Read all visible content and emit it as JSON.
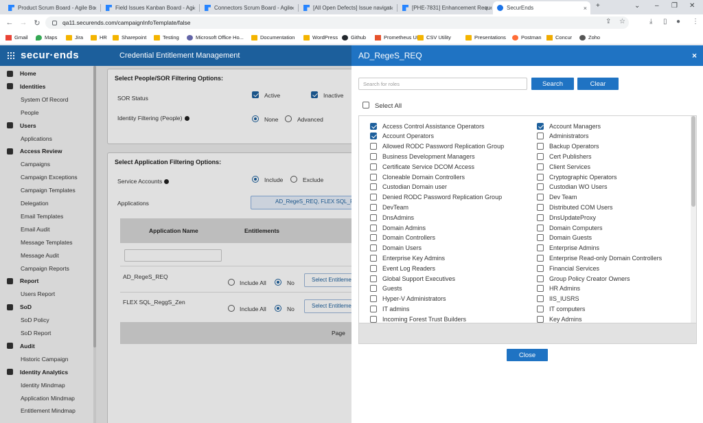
{
  "browser": {
    "tabs": [
      {
        "label": "Product Scrum Board - Agile Bo"
      },
      {
        "label": "Field Issues Kanban Board - Agi"
      },
      {
        "label": "Connectors Scrum Board - Agile"
      },
      {
        "label": "[All Open Defects] Issue navigat"
      },
      {
        "label": "[PHE-7831] Enhancement Reque"
      },
      {
        "label": "SecurEnds"
      }
    ],
    "new_tab": "+",
    "url": "qa11.securends.com/campaignInfoTemplate/false",
    "bookmarks": [
      {
        "label": "Gmail"
      },
      {
        "label": "Maps"
      },
      {
        "label": "Jira"
      },
      {
        "label": "HR"
      },
      {
        "label": "Sharepoint"
      },
      {
        "label": "Testing"
      },
      {
        "label": "Microsoft Office Ho..."
      },
      {
        "label": "Documentation"
      },
      {
        "label": "WordPress"
      },
      {
        "label": "Github"
      },
      {
        "label": "Prometheus UI"
      },
      {
        "label": "CSV Utility"
      },
      {
        "label": "Presentations"
      },
      {
        "label": "Postman"
      },
      {
        "label": "Concur"
      },
      {
        "label": "Zoho"
      }
    ]
  },
  "app": {
    "logo": "secur·ends",
    "title": "Credential Entitlement Management"
  },
  "sidebar": [
    {
      "type": "sec",
      "label": "Home",
      "icon": "home-icon"
    },
    {
      "type": "sec",
      "label": "Identities",
      "icon": "people-icon"
    },
    {
      "type": "sub",
      "label": "System Of Record"
    },
    {
      "type": "sub",
      "label": "People"
    },
    {
      "type": "sec",
      "label": "Users",
      "icon": "user-icon"
    },
    {
      "type": "sub",
      "label": "Applications"
    },
    {
      "type": "sec",
      "label": "Access Review",
      "icon": "access-review-icon"
    },
    {
      "type": "sub",
      "label": "Campaigns"
    },
    {
      "type": "sub",
      "label": "Campaign Exceptions"
    },
    {
      "type": "sub",
      "label": "Campaign Templates"
    },
    {
      "type": "sub",
      "label": "Delegation"
    },
    {
      "type": "sub",
      "label": "Email Templates"
    },
    {
      "type": "sub",
      "label": "Email Audit"
    },
    {
      "type": "sub",
      "label": "Message Templates"
    },
    {
      "type": "sub",
      "label": "Message Audit"
    },
    {
      "type": "sub",
      "label": "Campaign Reports"
    },
    {
      "type": "sec",
      "label": "Report",
      "icon": "report-icon"
    },
    {
      "type": "sub",
      "label": "Users Report"
    },
    {
      "type": "sec",
      "label": "SoD",
      "icon": "sod-icon"
    },
    {
      "type": "sub",
      "label": "SoD Policy"
    },
    {
      "type": "sub",
      "label": "SoD Report"
    },
    {
      "type": "sec",
      "label": "Audit",
      "icon": "shield-icon"
    },
    {
      "type": "sub",
      "label": "Historic Campaign"
    },
    {
      "type": "sec",
      "label": "Identity Analytics",
      "icon": "analytics-icon"
    },
    {
      "type": "sub",
      "label": "Identity Mindmap"
    },
    {
      "type": "sub",
      "label": "Application Mindmap"
    },
    {
      "type": "sub",
      "label": "Entitlement Mindmap"
    }
  ],
  "main": {
    "people_panel": {
      "title": "Select People/SOR Filtering Options:",
      "sor_status_label": "SOR Status",
      "active_label": "Active",
      "inactive_label": "Inactive",
      "identity_filtering_label": "Identity Filtering (People)",
      "none_label": "None",
      "advanced_label": "Advanced"
    },
    "app_panel": {
      "title": "Select Application Filtering Options:",
      "service_accounts_label": "Service Accounts",
      "include_label": "Include",
      "exclude_label": "Exclude",
      "applications_label": "Applications",
      "applications_value": "AD_RegeS_REQ, FLEX SQL_Re",
      "col_app_name": "Application Name",
      "col_entitlements": "Entitlements",
      "rows": [
        {
          "name": "AD_RegeS_REQ",
          "include_all": "Include All",
          "no": "No",
          "select": "Select Entitlements"
        },
        {
          "name": "FLEX SQL_ReggS_Zen",
          "include_all": "Include All",
          "no": "No",
          "select": "Select Entitlements"
        }
      ],
      "page_label": "Page"
    }
  },
  "modal": {
    "title": "AD_RegeS_REQ",
    "close_icon": "×",
    "search_placeholder": "Search for roles",
    "search_button": "Search",
    "clear_button": "Clear",
    "select_all_label": "Select All",
    "close_button": "Close",
    "roles_left": [
      {
        "label": "Access Control Assistance Operators",
        "checked": true
      },
      {
        "label": "Account Operators",
        "checked": true
      },
      {
        "label": "Allowed RODC Password Replication Group",
        "checked": false
      },
      {
        "label": "Business Development Managers",
        "checked": false
      },
      {
        "label": "Certificate Service DCOM Access",
        "checked": false
      },
      {
        "label": "Cloneable Domain Controllers",
        "checked": false
      },
      {
        "label": "Custodian Domain user",
        "checked": false
      },
      {
        "label": "Denied RODC Password Replication Group",
        "checked": false
      },
      {
        "label": "DevTeam",
        "checked": false
      },
      {
        "label": "DnsAdmins",
        "checked": false
      },
      {
        "label": "Domain Admins",
        "checked": false
      },
      {
        "label": "Domain Controllers",
        "checked": false
      },
      {
        "label": "Domain Users",
        "checked": false
      },
      {
        "label": "Enterprise Key Admins",
        "checked": false
      },
      {
        "label": "Event Log Readers",
        "checked": false
      },
      {
        "label": "Global Support Executives",
        "checked": false
      },
      {
        "label": "Guests",
        "checked": false
      },
      {
        "label": "Hyper-V Administrators",
        "checked": false
      },
      {
        "label": "IT admins",
        "checked": false
      },
      {
        "label": "Incoming Forest Trust Builders",
        "checked": false
      }
    ],
    "roles_right": [
      {
        "label": "Account Managers",
        "checked": true
      },
      {
        "label": "Administrators",
        "checked": false
      },
      {
        "label": "Backup Operators",
        "checked": false
      },
      {
        "label": "Cert Publishers",
        "checked": false
      },
      {
        "label": "Client Services",
        "checked": false
      },
      {
        "label": "Cryptographic Operators",
        "checked": false
      },
      {
        "label": "Custodian WO Users",
        "checked": false
      },
      {
        "label": "Dev Team",
        "checked": false
      },
      {
        "label": "Distributed COM Users",
        "checked": false
      },
      {
        "label": "DnsUpdateProxy",
        "checked": false
      },
      {
        "label": "Domain Computers",
        "checked": false
      },
      {
        "label": "Domain Guests",
        "checked": false
      },
      {
        "label": "Enterprise Admins",
        "checked": false
      },
      {
        "label": "Enterprise Read-only Domain Controllers",
        "checked": false
      },
      {
        "label": "Financial Services",
        "checked": false
      },
      {
        "label": "Group Policy Creator Owners",
        "checked": false
      },
      {
        "label": "HR Admins",
        "checked": false
      },
      {
        "label": "IIS_IUSRS",
        "checked": false
      },
      {
        "label": "IT computers",
        "checked": false
      },
      {
        "label": "Key Admins",
        "checked": false
      }
    ]
  },
  "colors": {
    "app_header": "#1c5f9c",
    "modal_header": "#1f73c3",
    "button": "#1f73c3"
  }
}
